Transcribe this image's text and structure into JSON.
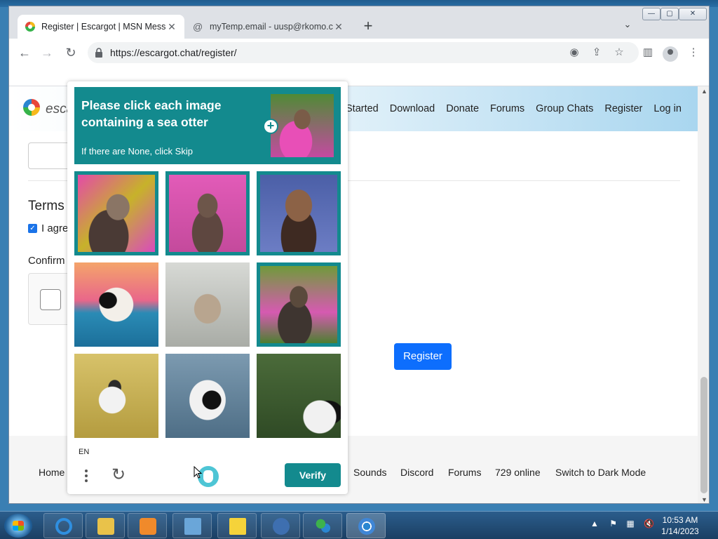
{
  "browser": {
    "tabs": [
      {
        "title": "Register | Escargot | MSN Messe",
        "active": true
      },
      {
        "title": "myTemp.email - uusp@rkomo.co",
        "active": false
      }
    ],
    "url": "https://escargot.chat/register/",
    "window_controls": {
      "minimize": "—",
      "maximize": "▢",
      "close": "✕"
    }
  },
  "site": {
    "brand": "esca",
    "nav": [
      "Started",
      "Download",
      "Donate",
      "Forums",
      "Group Chats",
      "Register",
      "Log in"
    ],
    "terms_heading": "Terms",
    "agree_text": "I agre",
    "confirm_label": "Confirm",
    "register_button": "Register",
    "footer_links": [
      "Home",
      "Sounds",
      "Discord",
      "Forums",
      "729 online",
      "Switch to Dark Mode"
    ],
    "colors": {
      "primary": "#0d6efd"
    }
  },
  "captcha": {
    "prompt_title": "Please click each image containing a sea otter",
    "prompt_subtitle": "If there are None, click Skip",
    "language": "EN",
    "verify_label": "Verify",
    "accent_color": "#138a8e",
    "tiles": [
      {
        "subject": "sea otter",
        "selected": true
      },
      {
        "subject": "sea otter",
        "selected": true
      },
      {
        "subject": "sea otter",
        "selected": true
      },
      {
        "subject": "panda",
        "selected": false
      },
      {
        "subject": "rabbit",
        "selected": false
      },
      {
        "subject": "sea otter",
        "selected": true
      },
      {
        "subject": "rabbit",
        "selected": false
      },
      {
        "subject": "panda",
        "selected": false
      },
      {
        "subject": "panda",
        "selected": false
      }
    ]
  },
  "taskbar": {
    "time": "10:53 AM",
    "date": "1/14/2023"
  }
}
